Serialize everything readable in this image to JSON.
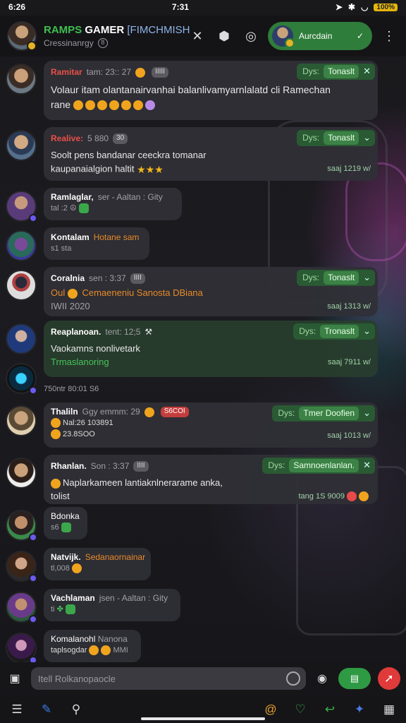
{
  "status_bar": {
    "time_left": "6:26",
    "time_center": "7:31",
    "battery": "100%"
  },
  "header": {
    "title_part1": "RAMPS",
    "title_part2": "GAMER",
    "title_part3": "[FIMCHMISH",
    "subtitle": "Cressinanrgy",
    "user_pill_name": "Aurcdain"
  },
  "messages": [
    {
      "name": "Ramitar",
      "meta": "tam: 23:: 27",
      "name_color": "#e8504a",
      "text": "Volaur itam olantanairvanhai balanlivamyarnlalatd cli Ramechan",
      "text2": "rane",
      "tag_label": "Dys:",
      "tag_value": "Tonaslt",
      "emojis": 6
    },
    {
      "name": "Realive:",
      "meta": "5 880",
      "pill": "30",
      "text": "Soolt pens bandanar ceeckra tomanar",
      "text2": "kaupanaialgion haltit",
      "tag_label": "Dys:",
      "tag_value": "Tonaslt",
      "time": "saaj 1219 w/"
    },
    {
      "name": "Ramlaglar,",
      "meta": "ser - Aaltan : Gity",
      "text": "tal :2"
    },
    {
      "name": "Kontalam",
      "meta": "Hotane sam",
      "text": "s1 sta"
    },
    {
      "name": "Coralnia",
      "meta": "sen : 3:37",
      "text_orange": "Oul",
      "text": "Cemaeneniu Sanosta DBiana",
      "text2": "IWII 2020",
      "tag_label": "Dys:",
      "tag_value": "Tonaslt",
      "time": "saaj 1313 w/"
    },
    {
      "name": "Reaplanoan.",
      "meta": "tent: 12;5",
      "text": "Vaokamns nonlivetark",
      "text_green": "Trmaslanoring",
      "tag_label": "Dys:",
      "tag_value": "Tronaslt",
      "time": "saaj 7911 w/",
      "footnote": "750ntr 80:01 S6"
    },
    {
      "name": "Thaliln",
      "meta": "Ggy emmm: 29",
      "pill_red": "S6COI",
      "text": "Nal:26 103891",
      "text2": "23.8SOO",
      "tag_label": "Dys:",
      "tag_value": "Tmer Doofien",
      "time": "saaj 1013 w/"
    },
    {
      "name": "Rhanlan.",
      "meta": "Son : 3:37",
      "text": "Naplarkameen lantiaknlnerarame anka,",
      "text2": "tolist",
      "tag_label": "Dys:",
      "tag_value": "Samnoenlanlan.",
      "time": "tang 1S 9009"
    },
    {
      "name": "Bdonka",
      "text": "s6"
    },
    {
      "name": "Natvijk.",
      "meta": "Sedanaornainar",
      "text": "tl,008"
    },
    {
      "name": "Vachlaman",
      "meta": "jsen - Aaltan : Gity",
      "text": "ti"
    },
    {
      "name": "Komalanohl",
      "meta": "Nanona",
      "text": "taplsogdar",
      "text2": "MMI"
    }
  ],
  "input": {
    "placeholder": "Itell Rolkanopaocle"
  },
  "colors": {
    "accent_green": "#2f9a44",
    "name_red": "#e8504a",
    "record_red": "#e03a3a",
    "tag_bg": "#2a5a33"
  }
}
